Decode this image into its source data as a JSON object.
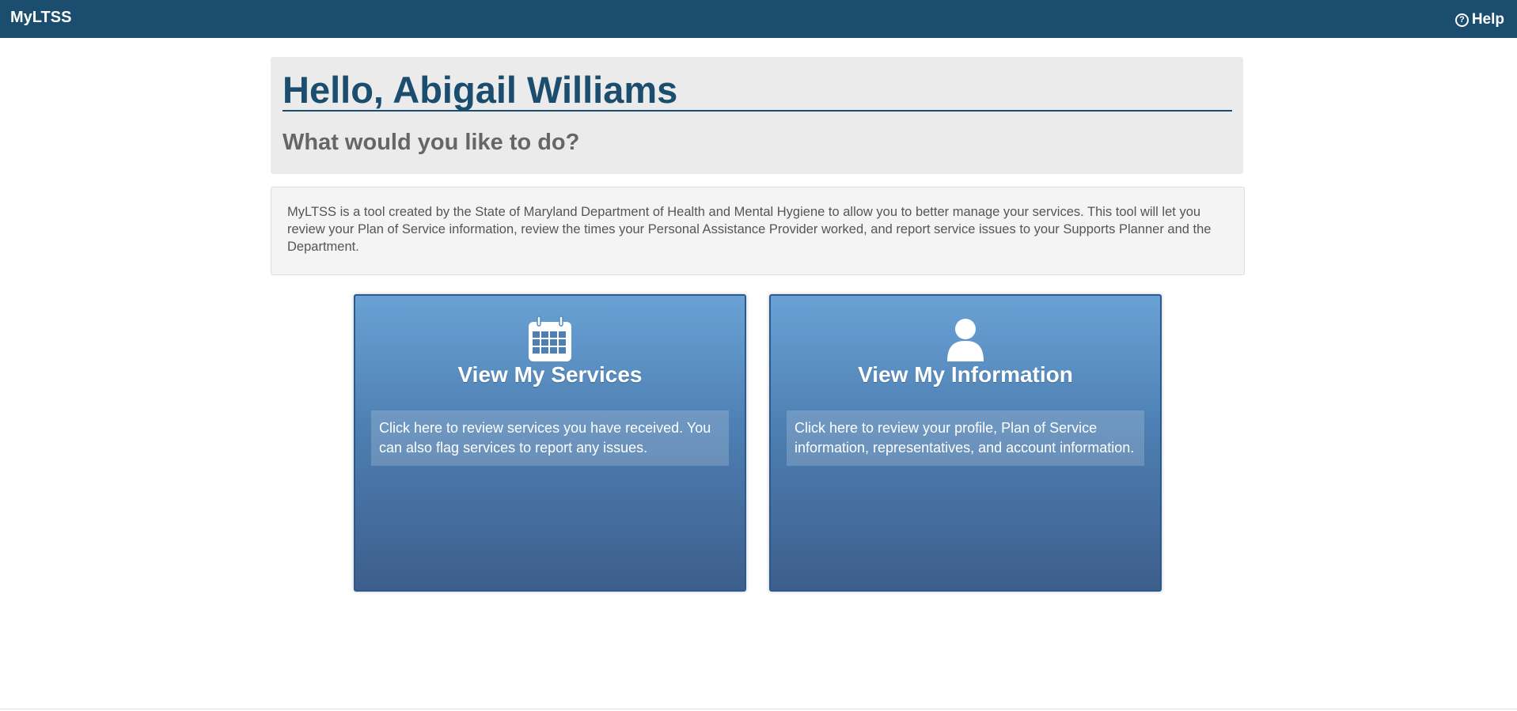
{
  "header": {
    "brand": "MyLTSS",
    "help_label": "Help",
    "help_icon": "question-circle-icon",
    "background_color": "#1a4d6e"
  },
  "greeting": {
    "title": "Hello, Abigail Williams",
    "subtitle": "What would you like to do?"
  },
  "intro": {
    "text": "MyLTSS is a tool created by the State of Maryland Department of Health and Mental Hygiene to allow you to better manage your services. This tool will let you review your Plan of Service information, review the times your Personal Assistance Provider worked, and report service issues to your Supports Planner and the Department."
  },
  "cards": [
    {
      "icon": "calendar-icon",
      "title": "View My Services",
      "description": "Click here to review services you have received. You can also flag services to report any issues."
    },
    {
      "icon": "user-icon",
      "title": "View My Information",
      "description": "Click here to review your profile, Plan of Service information, representatives, and account information."
    }
  ],
  "colors": {
    "primary": "#1a4d6e",
    "card_top": "#6aa2d5",
    "card_bottom": "#3d5e8c"
  }
}
